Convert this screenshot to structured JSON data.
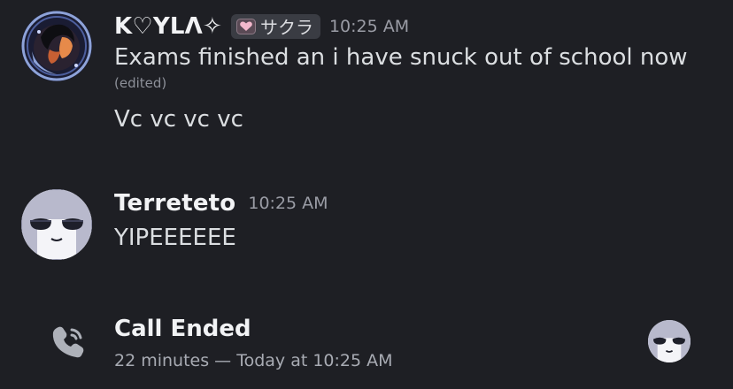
{
  "messages": [
    {
      "username": "K♡YLΛ✧",
      "tag": {
        "icon": "pink-heart-icon",
        "text": "サクラ"
      },
      "timestamp": "10:25 AM",
      "lines": [
        "Exams finished an i have snuck out of school now",
        "Vc vc vc vc"
      ],
      "edited_label": "(edited)",
      "avatar_icon": "anime-girl-moon-avatar-icon"
    },
    {
      "username": "Terreteto",
      "timestamp": "10:25 AM",
      "lines": [
        "YIPEEEEEE"
      ],
      "avatar_icon": "cartoon-face-avatar-icon"
    }
  ],
  "call": {
    "icon": "phone-call-icon",
    "title": "Call Ended",
    "details": "22 minutes — Today at 10:25 AM",
    "participant_avatar_icon": "cartoon-face-avatar-icon"
  },
  "colors": {
    "background": "#1e1f24",
    "username": "#f2f3f5",
    "text": "#dbdee1",
    "muted": "#9a9ca5",
    "tag_bg": "#3a3c43"
  }
}
